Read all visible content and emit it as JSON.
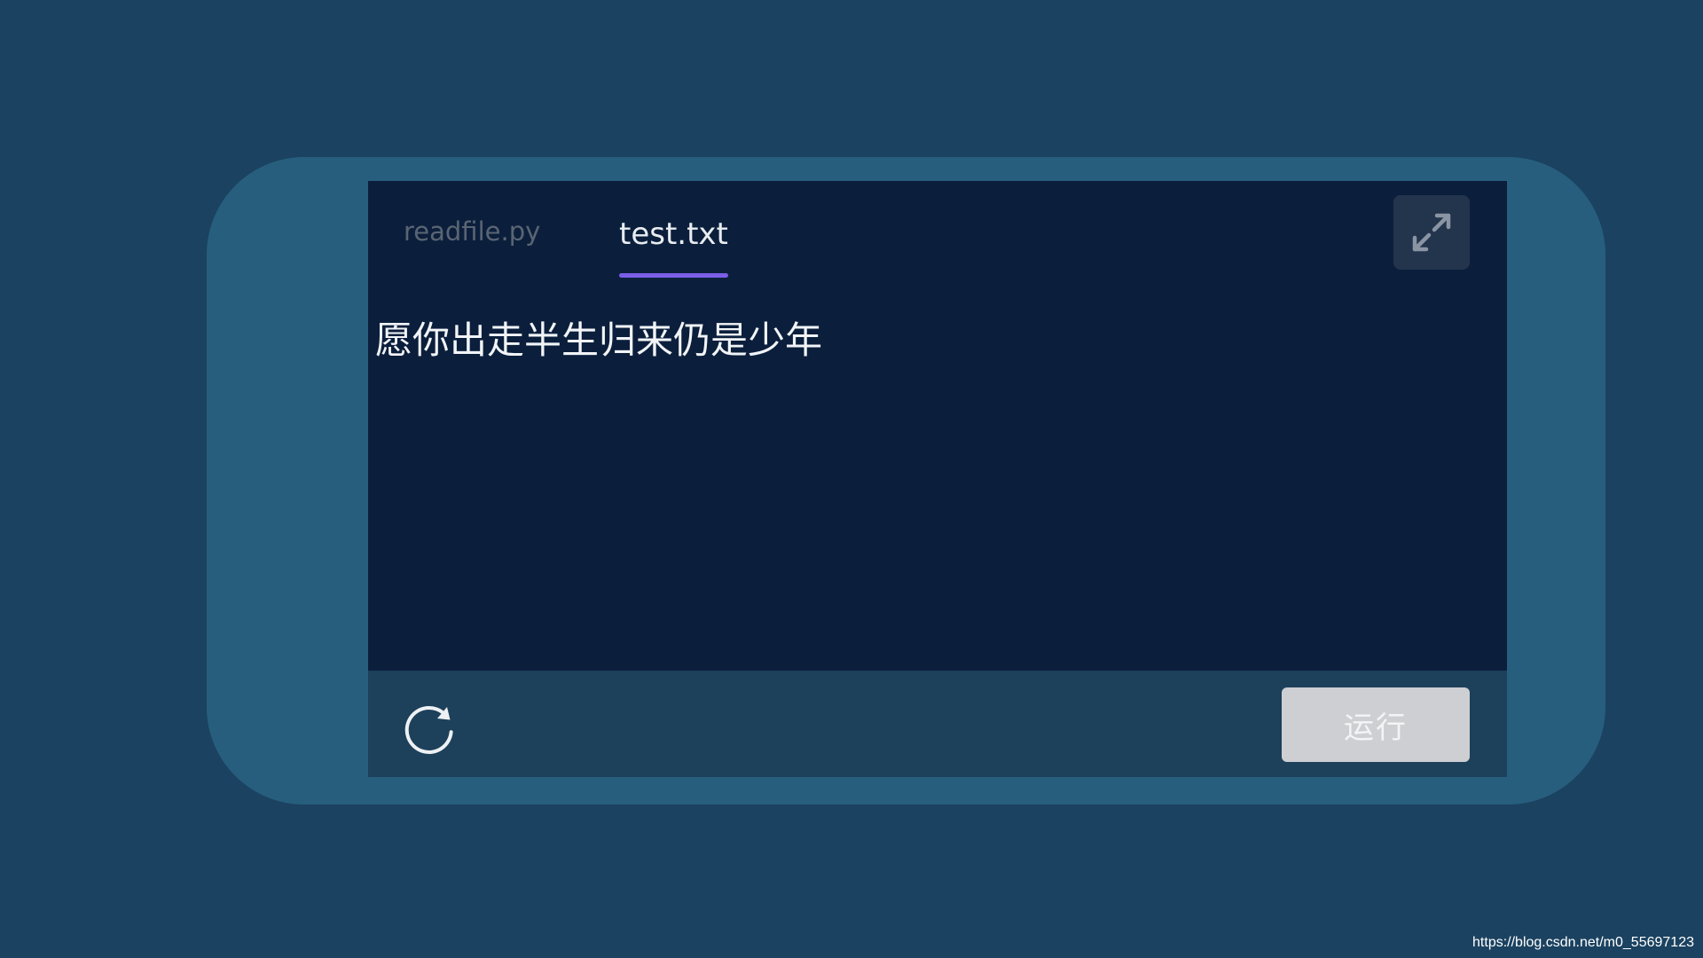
{
  "editor": {
    "tabs": [
      {
        "label": "readfile.py",
        "active": false
      },
      {
        "label": "test.txt",
        "active": true
      }
    ],
    "content": "愿你出走半生归来仍是少年",
    "expand_icon": "expand-icon",
    "accent_color": "#7b5ee8"
  },
  "toolbar": {
    "refresh_icon": "refresh-icon",
    "run_label": "运行"
  },
  "watermark": "https://blog.csdn.net/m0_55697123"
}
